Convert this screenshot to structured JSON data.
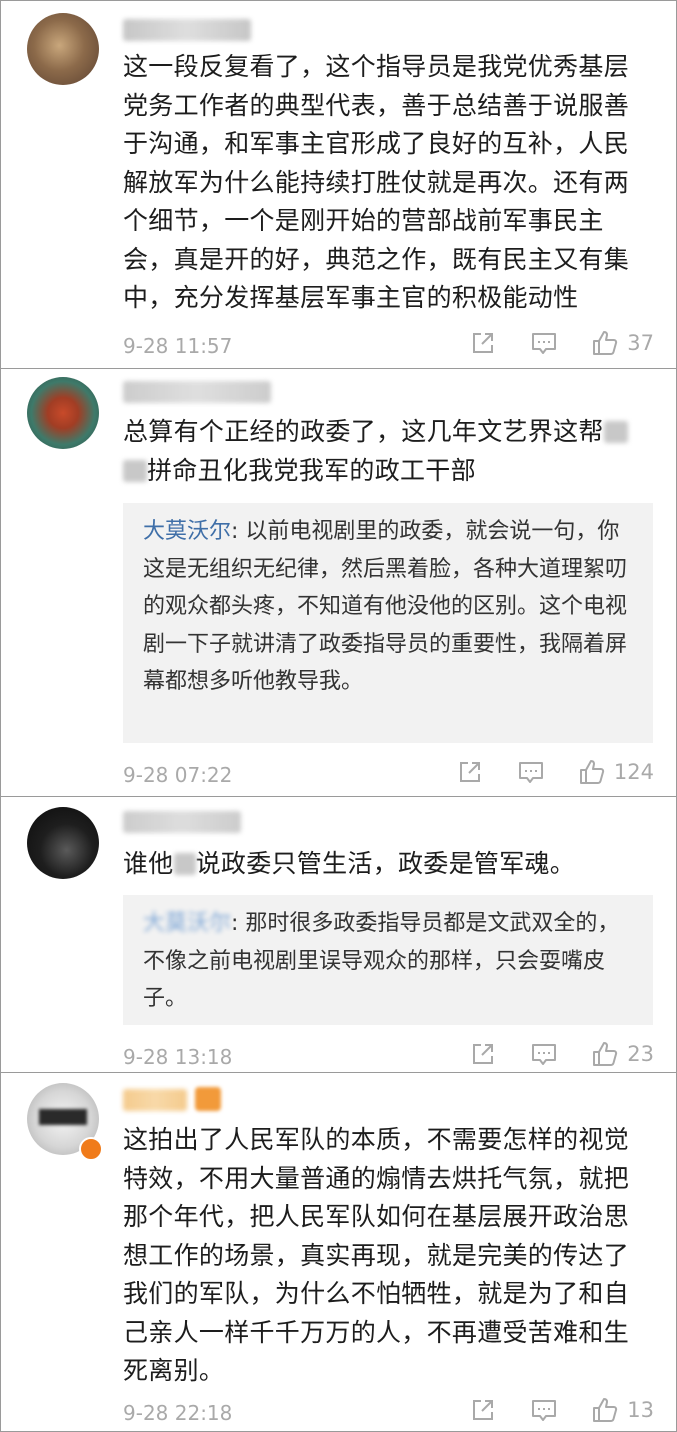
{
  "comments": [
    {
      "time": "9-28 11:57",
      "likes": "37",
      "text": "这一段反复看了，这个指导员是我党优秀基层党务工作者的典型代表，善于总结善于说服善于沟通，和军事主官形成了良好的互补，人民解放军为什么能持续打胜仗就是再次。还有两个细节，一个是刚开始的营部战前军事民主会，真是开的好，典范之作，既有民主又有集中，充分发挥基层军事主官的积极能动性"
    },
    {
      "time": "9-28 07:22",
      "likes": "124",
      "text_a": "总算有个正经的政委了，这几年文艺界这帮",
      "text_b": "拼命丑化我党我军的政工干部",
      "reply_name": "大莫沃尔",
      "reply_text": ": 以前电视剧里的政委，就会说一句，你这是无组织无纪律，然后黑着脸，各种大道理絮叨的观众都头疼，不知道有他没他的区别。这个电视剧一下子就讲清了政委指导员的重要性，我隔着屏幕都想多听他教导我。"
    },
    {
      "time": "9-28 13:18",
      "likes": "23",
      "text_a": "谁他",
      "text_b": "说政委只管生活，政委是管军魂。",
      "reply_name": "大莫沃尔",
      "reply_text": ": 那时很多政委指导员都是文武双全的，不像之前电视剧里误导观众的那样，只会耍嘴皮子。"
    },
    {
      "time": "9-28 22:18",
      "likes": "13",
      "text": "这拍出了人民军队的本质，不需要怎样的视觉特效，不用大量普通的煽情去烘托气氛，就把那个年代，把人民军队如何在基层展开政治思想工作的场景，真实再现，就是完美的传达了我们的军队，为什么不怕牺牲，就是为了和自己亲人一样千千万万的人，不再遭受苦难和生死离别。"
    }
  ],
  "icons": {
    "share": "share-icon",
    "reply": "reply-icon",
    "like": "thumbs-up-icon"
  },
  "colors": {
    "reply_name": "#3f6fa8",
    "meta": "#a9a9a9",
    "reply_bg": "#f2f2f2"
  }
}
